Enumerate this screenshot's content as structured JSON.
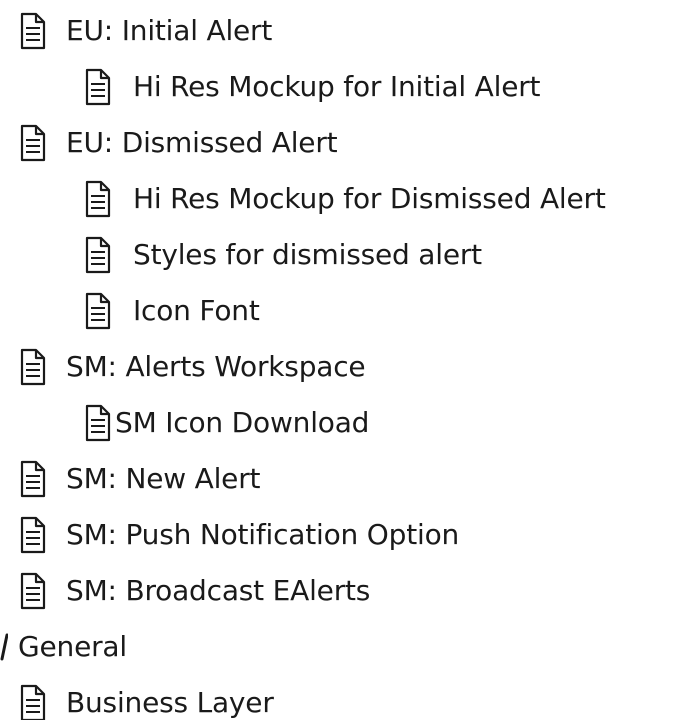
{
  "tree": {
    "items": [
      {
        "label": "EU: Initial Alert",
        "icon": "document-icon"
      },
      {
        "label": "Hi Res Mockup for Initial Alert",
        "icon": "document-icon"
      },
      {
        "label": "EU: Dismissed Alert",
        "icon": "document-icon"
      },
      {
        "label": "Hi Res Mockup for Dismissed Alert",
        "icon": "document-icon"
      },
      {
        "label": "Styles for dismissed alert",
        "icon": "document-icon"
      },
      {
        "label": "Icon Font",
        "icon": "document-icon"
      },
      {
        "label": "SM: Alerts Workspace",
        "icon": "document-icon"
      },
      {
        "label": "SM Icon Download",
        "icon": "document-icon"
      },
      {
        "label": "SM: New Alert",
        "icon": "document-icon"
      },
      {
        "label": "SM: Push Notification Option",
        "icon": "document-icon"
      },
      {
        "label": "SM: Broadcast EAlerts",
        "icon": "document-icon"
      },
      {
        "label": "General",
        "icon": "folder-open-icon"
      },
      {
        "label": "Business Layer",
        "icon": "document-icon"
      }
    ]
  }
}
